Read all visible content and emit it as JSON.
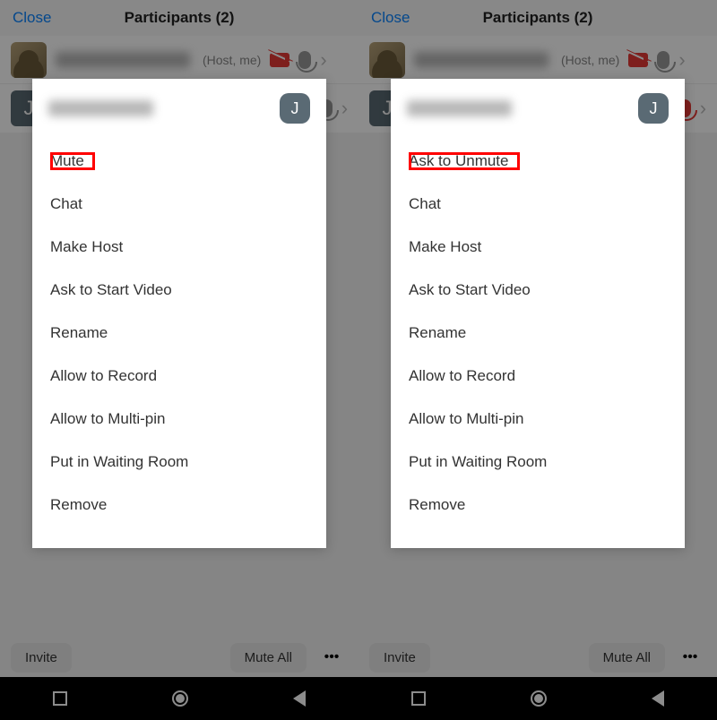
{
  "left": {
    "header": {
      "close": "Close",
      "title": "Participants (2)"
    },
    "row1": {
      "tag": "(Host, me)"
    },
    "menu": {
      "avatar": "J",
      "items": [
        "Mute",
        "Chat",
        "Make Host",
        "Ask to Start Video",
        "Rename",
        "Allow to Record",
        "Allow to Multi-pin",
        "Put in Waiting Room",
        "Remove"
      ],
      "highlight_index": 0
    },
    "bottom": {
      "invite": "Invite",
      "mute_all": "Mute All"
    },
    "peek_avatar": "J"
  },
  "right": {
    "header": {
      "close": "Close",
      "title": "Participants (2)"
    },
    "row1": {
      "tag": "(Host, me)"
    },
    "menu": {
      "avatar": "J",
      "items": [
        "Ask to Unmute",
        "Chat",
        "Make Host",
        "Ask to Start Video",
        "Rename",
        "Allow to Record",
        "Allow to Multi-pin",
        "Put in Waiting Room",
        "Remove"
      ],
      "highlight_index": 0
    },
    "bottom": {
      "invite": "Invite",
      "mute_all": "Mute All"
    },
    "peek_avatar": "J"
  }
}
